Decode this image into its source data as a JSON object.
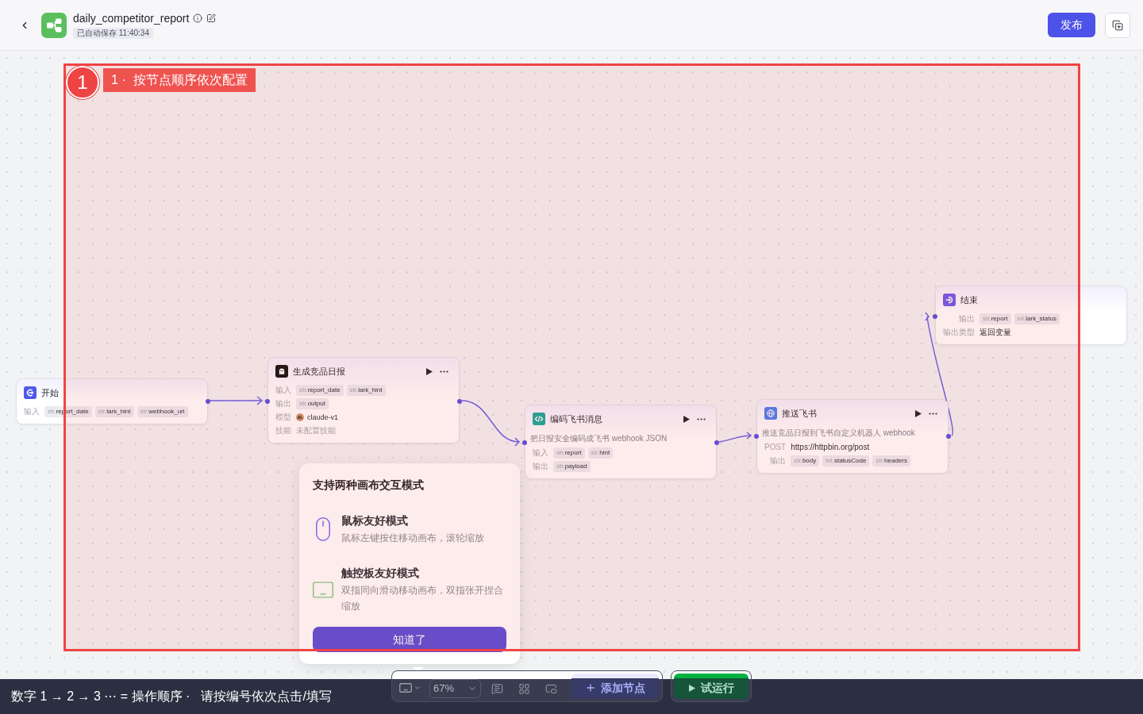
{
  "header": {
    "title": "daily_competitor_report",
    "autosave": "已自动保存 11:40:34",
    "publish": "发布"
  },
  "annotation": {
    "number": "1",
    "label": "1 ·  按节点顺序依次配置"
  },
  "nodes": [
    {
      "kind": "start",
      "title": "开始",
      "rows": [
        {
          "kind": "params",
          "label": "输入",
          "params": [
            {
              "type": "str.",
              "name": "report_date"
            },
            {
              "type": "str.",
              "name": "lark_hint"
            },
            {
              "type": "str.",
              "name": "webhook_url"
            }
          ]
        }
      ]
    },
    {
      "kind": "llm",
      "title": "生成竞品日报",
      "rows": [
        {
          "kind": "params",
          "label": "输入",
          "params": [
            {
              "type": "str.",
              "name": "report_date"
            },
            {
              "type": "str.",
              "name": "lark_hint"
            }
          ]
        },
        {
          "kind": "params",
          "label": "输出",
          "params": [
            {
              "type": "str.",
              "name": "output"
            }
          ]
        },
        {
          "kind": "model",
          "label": "模型",
          "value": "claude-v1"
        },
        {
          "kind": "muted",
          "label": "技能",
          "value": "未配置技能"
        }
      ]
    },
    {
      "kind": "code",
      "title": "编码飞书消息",
      "description": "把日报安全编码成飞书 webhook JSON",
      "rows": [
        {
          "kind": "params",
          "label": "输入",
          "params": [
            {
              "type": "str.",
              "name": "report"
            },
            {
              "type": "str.",
              "name": "hint"
            }
          ]
        },
        {
          "kind": "params",
          "label": "输出",
          "params": [
            {
              "type": "str.",
              "name": "payload"
            }
          ]
        }
      ]
    },
    {
      "kind": "http",
      "title": "推送飞书",
      "description": "推送竞品日报到飞书自定义机器人 webhook",
      "rows": [
        {
          "kind": "text",
          "label": "POST",
          "value": "https://httpbin.org/post"
        },
        {
          "kind": "params",
          "label": "输出",
          "params": [
            {
              "type": "str.",
              "name": "body"
            },
            {
              "type": "int.",
              "name": "statusCode"
            },
            {
              "type": "str.",
              "name": "headers"
            }
          ]
        }
      ]
    },
    {
      "kind": "end",
      "title": "结束",
      "rows": [
        {
          "kind": "params",
          "label": "输出",
          "params": [
            {
              "type": "str.",
              "name": "report"
            },
            {
              "type": "int.",
              "name": "lark_status"
            }
          ]
        },
        {
          "kind": "text",
          "label": "输出类型",
          "value": "返回变量"
        }
      ]
    }
  ],
  "popover": {
    "title": "支持两种画布交互模式",
    "modes": [
      {
        "kind": "mouse",
        "title": "鼠标友好模式",
        "description": "鼠标左键按住移动画布，滚轮缩放"
      },
      {
        "kind": "touchpad",
        "title": "触控板友好模式",
        "description": "双指同向滑动移动画布，双指张开捏合缩放"
      }
    ],
    "button": "知道了"
  },
  "toolbar": {
    "interaction_mode": {
      "kind": "touchpad"
    },
    "zoom": "67%",
    "add_node": "添加节点",
    "test_run": "试运行"
  },
  "hint_bar": {
    "legend": "数字 1 → 2 → 3 ⋯ = 操作顺序 ·",
    "instruction": "请按编号依次点击/填写"
  }
}
